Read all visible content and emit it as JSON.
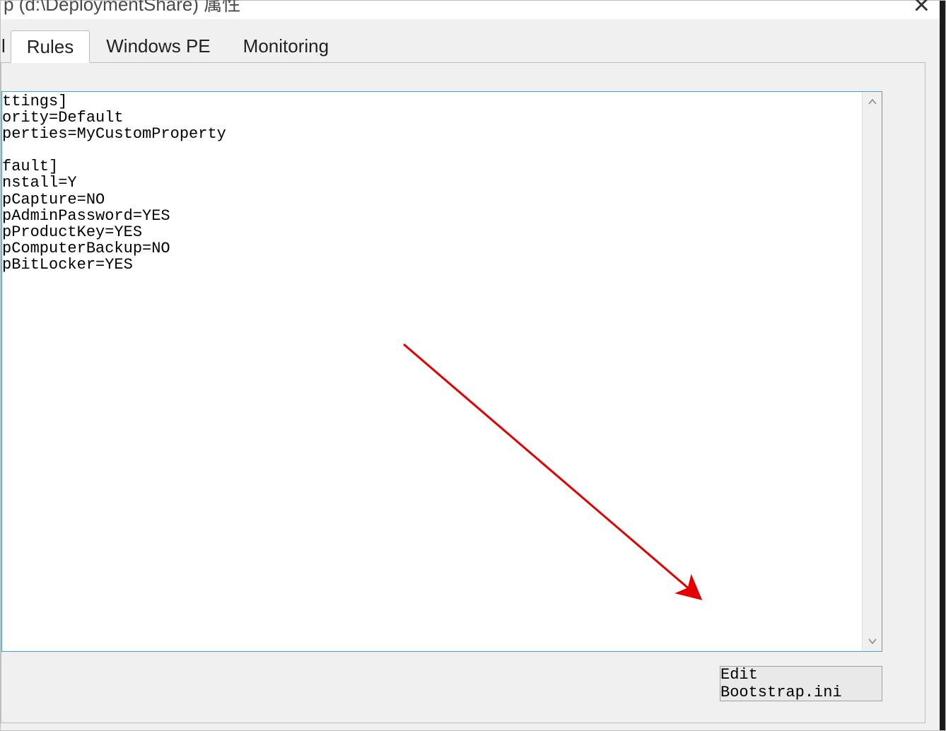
{
  "window": {
    "title_fragment": "p (d:\\DeploymentShare) 属性"
  },
  "tabs": {
    "partial_left": "l",
    "rules": "Rules",
    "windows_pe": "Windows PE",
    "monitoring": "Monitoring"
  },
  "rules_text": "ttings]\nority=Default\nperties=MyCustomProperty\n\nfault]\nnstall=Y\npCapture=NO\npAdminPassword=YES\npProductKey=YES\npComputerBackup=NO\npBitLocker=YES",
  "buttons": {
    "edit_bootstrap": "Edit Bootstrap.ini"
  }
}
